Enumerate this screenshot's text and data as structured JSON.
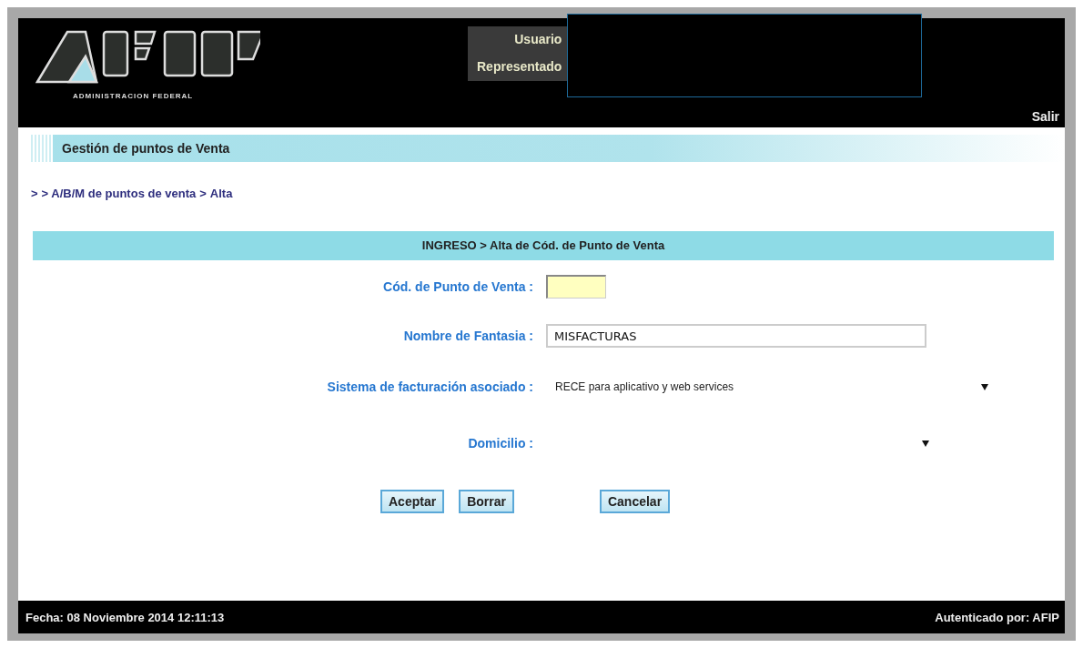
{
  "header": {
    "logo_caption": "ADMINISTRACION FEDERAL",
    "user_labels": [
      "Usuario",
      "Representado"
    ],
    "logout": "Salir"
  },
  "title_bar": "Gestión de puntos de Venta",
  "breadcrumb": [
    ">",
    "> A/B/M de puntos de venta",
    ">",
    "Alta"
  ],
  "form": {
    "heading": "INGRESO > Alta de Cód. de Punto de Venta",
    "fields": [
      {
        "kind": "code",
        "label": "Cód. de Punto de Venta :"
      },
      {
        "kind": "text",
        "label": "Nombre de Fantasia :",
        "value": "MISFACTURAS"
      },
      {
        "kind": "select",
        "label": "Sistema de facturación asociado :",
        "value": "RECE para aplicativo y web services"
      },
      {
        "kind": "select",
        "label": "Domicilio :"
      }
    ],
    "buttons": [
      "Aceptar",
      "Borrar",
      "Cancelar"
    ]
  },
  "footer": {
    "date": "Fecha: 08 Noviembre 2014 12:11:13",
    "auth": "Autenticado por: AFIP"
  }
}
